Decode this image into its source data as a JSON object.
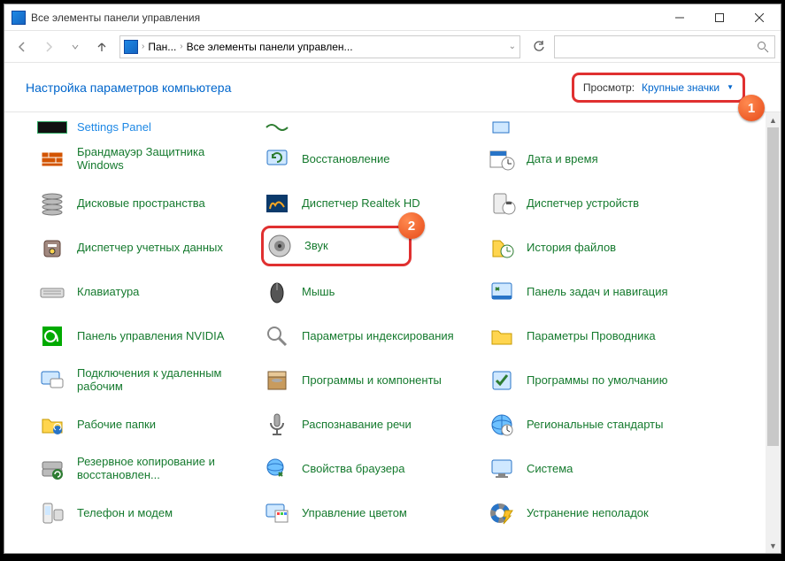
{
  "window": {
    "title": "Все элементы панели управления"
  },
  "nav": {
    "breadcrumb1": "Пан...",
    "breadcrumb2": "Все элементы панели управлен..."
  },
  "subheader": {
    "title": "Настройка параметров компьютера",
    "view_label": "Просмотр:",
    "view_value": "Крупные значки"
  },
  "callouts": {
    "one": "1",
    "two": "2"
  },
  "topRow": {
    "c0": "Settings Panel",
    "c1": "",
    "c2": ""
  },
  "items": [
    {
      "label": "Брандмауэр Защитника Windows",
      "icon": "firewall"
    },
    {
      "label": "Восстановление",
      "icon": "recovery"
    },
    {
      "label": "Дата и время",
      "icon": "datetime"
    },
    {
      "label": "Дисковые пространства",
      "icon": "disks"
    },
    {
      "label": "Диспетчер Realtek HD",
      "icon": "realtek"
    },
    {
      "label": "Диспетчер устройств",
      "icon": "devices"
    },
    {
      "label": "Диспетчер учетных данных",
      "icon": "creds"
    },
    {
      "label": "Звук",
      "icon": "sound",
      "highlight": true
    },
    {
      "label": "История файлов",
      "icon": "history"
    },
    {
      "label": "Клавиатура",
      "icon": "keyboard"
    },
    {
      "label": "Мышь",
      "icon": "mouse"
    },
    {
      "label": "Панель задач и навигация",
      "icon": "taskbar"
    },
    {
      "label": "Панель управления NVIDIA",
      "icon": "nvidia"
    },
    {
      "label": "Параметры индексирования",
      "icon": "index"
    },
    {
      "label": "Параметры Проводника",
      "icon": "explorer"
    },
    {
      "label": "Подключения к удаленным рабочим",
      "icon": "remote"
    },
    {
      "label": "Программы и компоненты",
      "icon": "programs"
    },
    {
      "label": "Программы по умолчанию",
      "icon": "defaults"
    },
    {
      "label": "Рабочие папки",
      "icon": "workdirs"
    },
    {
      "label": "Распознавание речи",
      "icon": "speech"
    },
    {
      "label": "Региональные стандарты",
      "icon": "region"
    },
    {
      "label": "Резервное копирование и восстановлен...",
      "icon": "backup"
    },
    {
      "label": "Свойства браузера",
      "icon": "inet"
    },
    {
      "label": "Система",
      "icon": "system"
    },
    {
      "label": "Телефон и модем",
      "icon": "phone"
    },
    {
      "label": "Управление цветом",
      "icon": "color"
    },
    {
      "label": "Устранение неполадок",
      "icon": "trouble"
    }
  ]
}
